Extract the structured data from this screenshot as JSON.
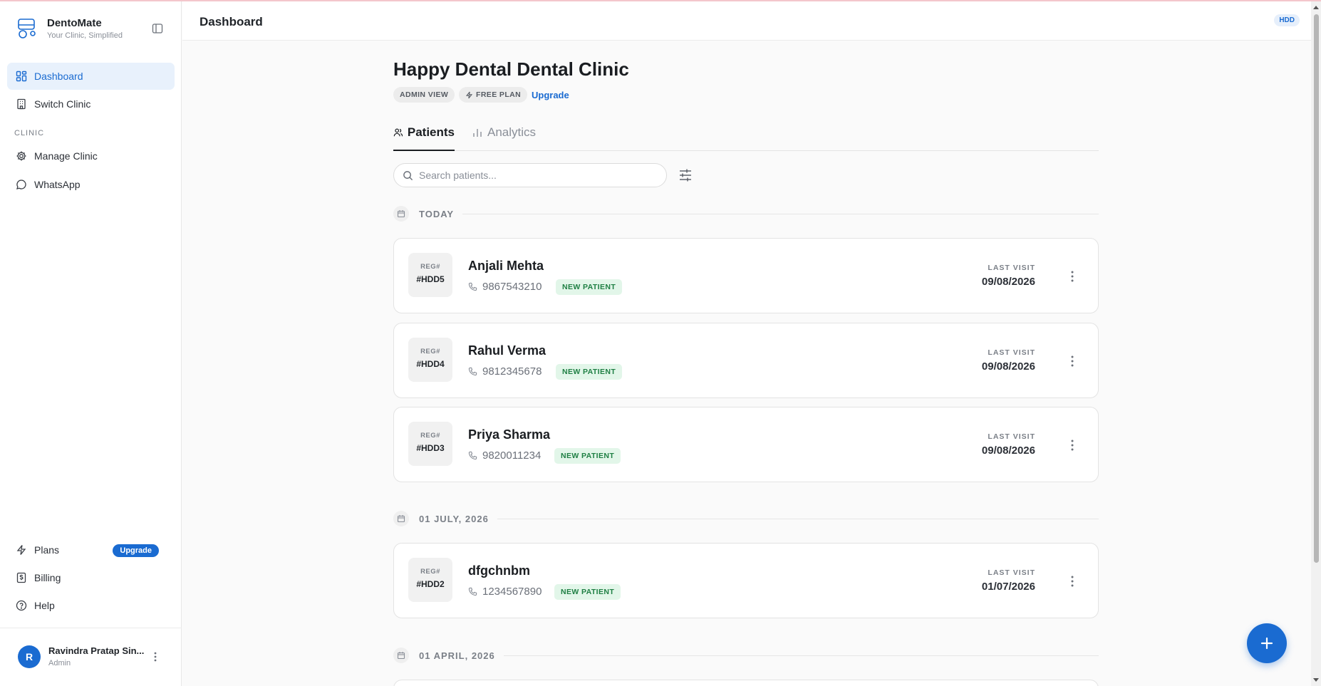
{
  "app": {
    "name": "DentoMate",
    "tagline": "Your Clinic, Simplified"
  },
  "sidebar": {
    "nav": [
      {
        "label": "Dashboard",
        "icon": "grid-icon",
        "active": true
      },
      {
        "label": "Switch Clinic",
        "icon": "building-icon"
      }
    ],
    "section_label": "CLINIC",
    "clinic_nav": [
      {
        "label": "Manage Clinic",
        "icon": "gear-icon"
      },
      {
        "label": "WhatsApp",
        "icon": "chat-icon"
      }
    ],
    "bottom_nav": [
      {
        "label": "Plans",
        "icon": "bolt-icon",
        "badge": "Upgrade"
      },
      {
        "label": "Billing",
        "icon": "receipt-icon"
      },
      {
        "label": "Help",
        "icon": "help-circle-icon"
      }
    ],
    "user": {
      "initial": "R",
      "name": "Ravindra Pratap Sin...",
      "role": "Admin"
    }
  },
  "header": {
    "title": "Dashboard",
    "badge": "HDD"
  },
  "main": {
    "clinic_title": "Happy Dental Dental Clinic",
    "chips": [
      "ADMIN VIEW",
      "FREE PLAN"
    ],
    "upgrade_link": "Upgrade",
    "tabs": [
      {
        "label": "Patients",
        "active": true
      },
      {
        "label": "Analytics",
        "active": false
      }
    ],
    "search_placeholder": "Search patients...",
    "groups": [
      {
        "date": "TODAY",
        "patients": [
          {
            "reg_label": "REG#",
            "reg_id": "#HDD5",
            "name": "Anjali Mehta",
            "phone": "9867543210",
            "badge": "NEW PATIENT",
            "last_visit_label": "LAST VISIT",
            "last_visit": "09/08/2026"
          },
          {
            "reg_label": "REG#",
            "reg_id": "#HDD4",
            "name": "Rahul Verma",
            "phone": "9812345678",
            "badge": "NEW PATIENT",
            "last_visit_label": "LAST VISIT",
            "last_visit": "09/08/2026"
          },
          {
            "reg_label": "REG#",
            "reg_id": "#HDD3",
            "name": "Priya Sharma",
            "phone": "9820011234",
            "badge": "NEW PATIENT",
            "last_visit_label": "LAST VISIT",
            "last_visit": "09/08/2026"
          }
        ]
      },
      {
        "date": "01 JULY, 2026",
        "patients": [
          {
            "reg_label": "REG#",
            "reg_id": "#HDD2",
            "name": "dfgchnbm",
            "phone": "1234567890",
            "badge": "NEW PATIENT",
            "last_visit_label": "LAST VISIT",
            "last_visit": "01/07/2026"
          }
        ]
      },
      {
        "date": "01 APRIL, 2026",
        "patients": []
      }
    ]
  },
  "colors": {
    "accent": "#1a6bd1",
    "badge_bg": "#e2f6e9",
    "badge_text": "#1e7f43"
  }
}
